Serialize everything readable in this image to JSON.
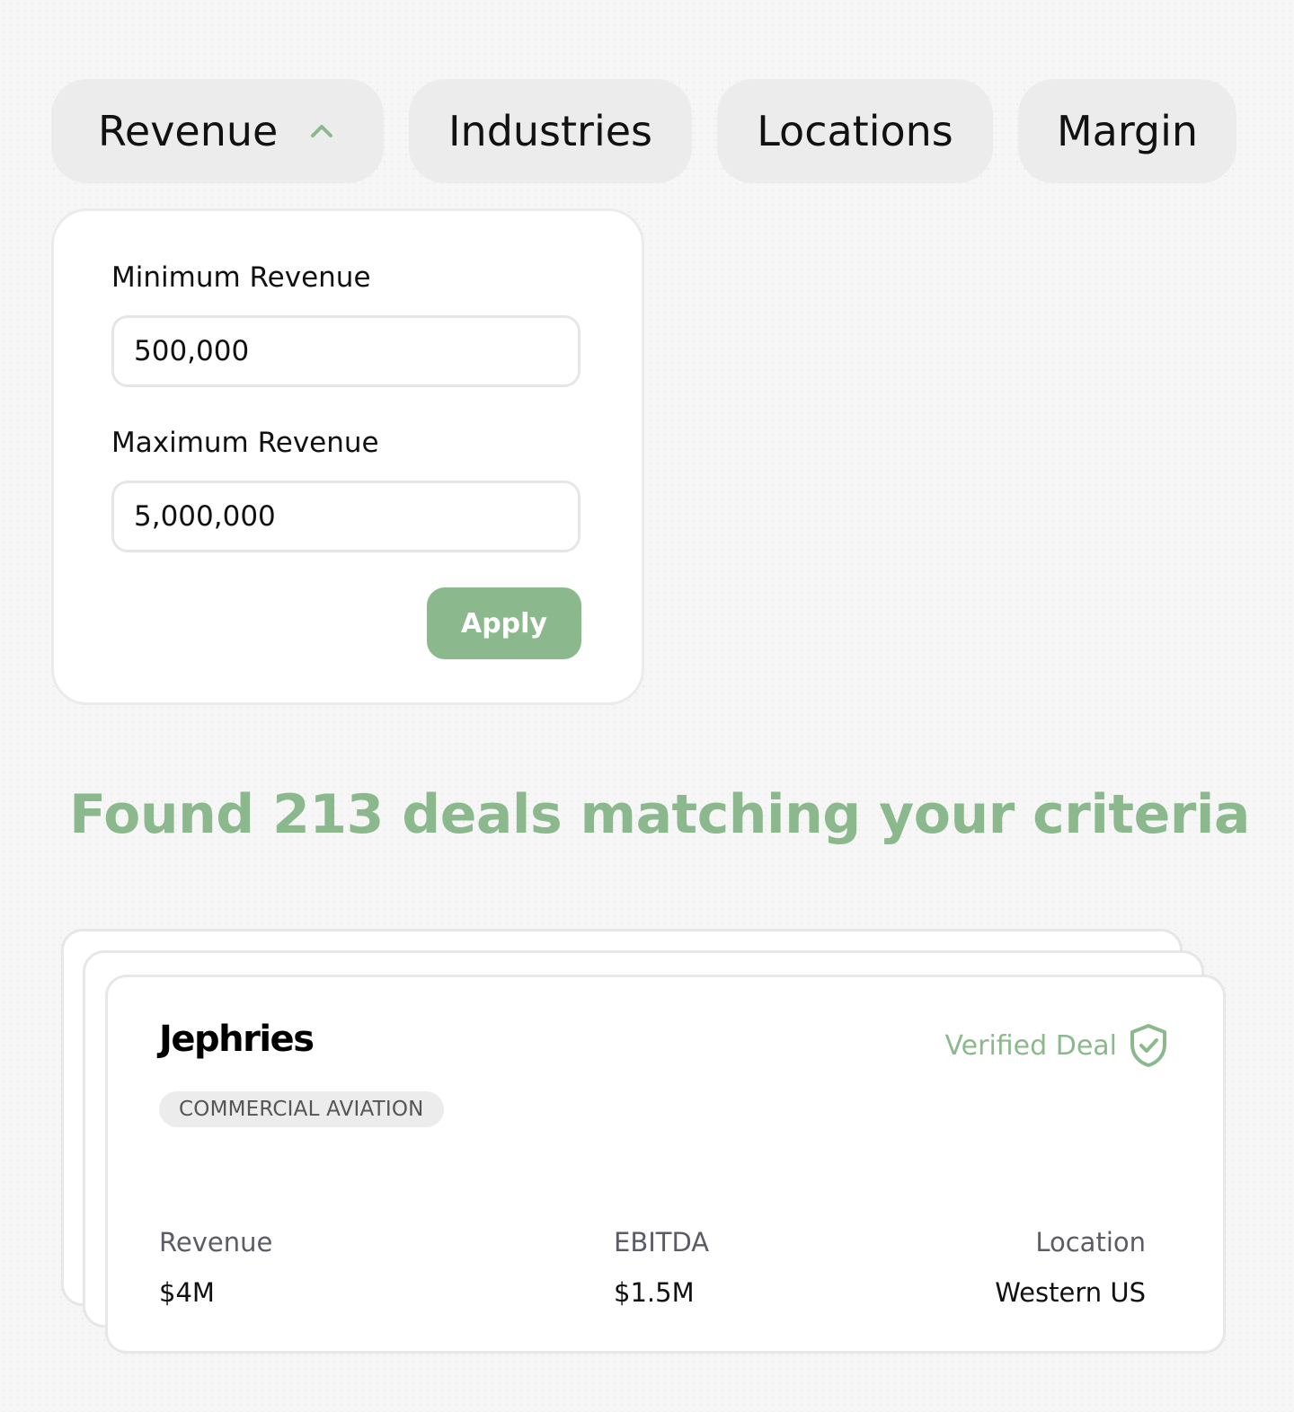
{
  "filters": {
    "revenue": "Revenue",
    "industries": "Industries",
    "locations": "Locations",
    "margin": "Margin"
  },
  "revenue_panel": {
    "min_label": "Minimum Revenue",
    "min_value": "500,000",
    "max_label": "Maximum Revenue",
    "max_value": "5,000,000",
    "apply_label": "Apply"
  },
  "results": {
    "heading": "Found 213 deals matching your criteria"
  },
  "deal": {
    "company": "Jephries",
    "industry": "COMMERCIAL AVIATION",
    "verified_label": "Verified Deal",
    "revenue_label": "Revenue",
    "revenue_value": "$4M",
    "ebitda_label": "EBITDA",
    "ebitda_value": "$1.5M",
    "location_label": "Location",
    "location_value": "Western US"
  },
  "icons": {
    "revenue_toggle": "chevron-up-icon",
    "verified": "shield-check-icon"
  },
  "colors": {
    "accent": "#8bb98d",
    "pill_bg": "#ececec",
    "card_border": "#e7e7e7"
  }
}
